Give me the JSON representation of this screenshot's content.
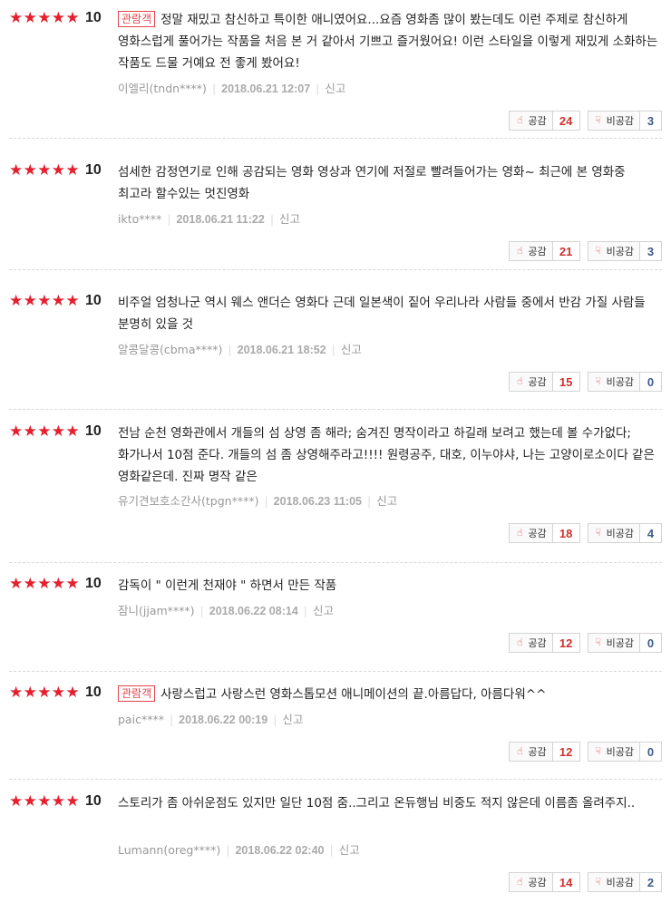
{
  "star_count": 5,
  "star_glyph": "★",
  "like_label": "공감",
  "dislike_label": "비공감",
  "report_label": "신고",
  "reviews": [
    {
      "score": "10",
      "badge": "관람객",
      "text": "정말 재밌고 참신하고 특이한 애니였어요...요즘 영화좀 많이 봤는데도 이런 주제로 참신하게 영화스럽게 풀어가는 작품을 처음 본 거 같아서 기쁘고 즐거웠어요! 이런 스타일을 이렇게 재밌게 소화하는 작품도 드물 거예요 전 좋게 봤어요!",
      "user": "이엘리(tndn****)",
      "date": "2018.06.21 12:07",
      "likes": "24",
      "dislikes": "3"
    },
    {
      "score": "10",
      "badge": "",
      "text": "섬세한 감정연기로 인해 공감되는 영화 영상과 연기에 저절로 빨려들어가는 영화~ 최근에 본 영화중 최고라 할수있는 멋진영화",
      "user": "ikto****",
      "date": "2018.06.21 11:22",
      "likes": "21",
      "dislikes": "3"
    },
    {
      "score": "10",
      "badge": "",
      "text": "비주얼 엄청나군 역시 웨스 앤더슨 영화다 근데 일본색이 짙어 우리나라 사람들 중에서 반감 가질 사람들 분명히 있을 것",
      "user": "알콩달콩(cbma****)",
      "date": "2018.06.21 18:52",
      "likes": "15",
      "dislikes": "0"
    },
    {
      "score": "10",
      "badge": "",
      "text": "전남 순천 영화관에서 개들의 섬 상영 좀 해라; 숨겨진 명작이라고 하길래 보려고 했는데 볼 수가없다; 화가나서 10점 준다. 개들의 섬 좀 상영해주라고!!!! 원령공주, 대호, 이누야샤, 나는 고양이로소이다 같은 영화같은데. 진짜 명작 같은",
      "user": "유기견보호소간사(tpgn****)",
      "date": "2018.06.23 11:05",
      "likes": "18",
      "dislikes": "4"
    },
    {
      "score": "10",
      "badge": "",
      "text": "감독이 \" 이런게 천재야 \" 하면서 만든 작품",
      "user": "잠니(jjam****)",
      "date": "2018.06.22 08:14",
      "likes": "12",
      "dislikes": "0"
    },
    {
      "score": "10",
      "badge": "관람객",
      "text": "사랑스럽고 사랑스런 영화스톱모션 애니메이션의 끝.아름답다, 아름다워^^",
      "user": "paic****",
      "date": "2018.06.22 00:19",
      "likes": "12",
      "dislikes": "0"
    },
    {
      "score": "10",
      "badge": "",
      "text": "스토리가 좀 아쉬운점도 있지만 일단 10점 줌..그리고 온듀행님 비중도 적지 않은데 이름좀 올려주지..",
      "user": "Lumann(oreg****)",
      "date": "2018.06.22 02:40",
      "likes": "14",
      "dislikes": "2"
    }
  ]
}
